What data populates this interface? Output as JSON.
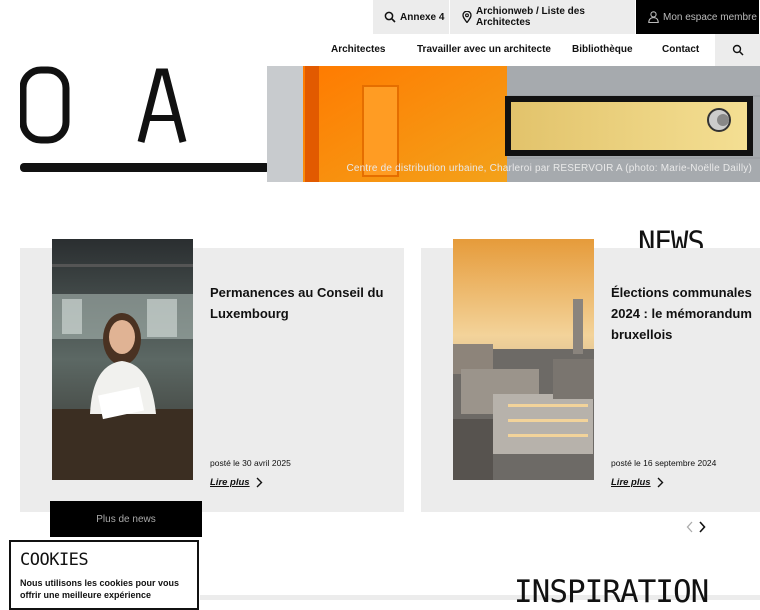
{
  "topbar": {
    "annexe": "Annexe 4",
    "archionweb": "Archionweb / Liste des Architectes",
    "member": "Mon espace membre"
  },
  "nav": {
    "items": [
      "Architectes",
      "Travailler avec un architecte",
      "Bibliothèque",
      "Contact"
    ]
  },
  "logo": {
    "letters": "O A"
  },
  "hero": {
    "caption": "Centre de distribution urbaine, Charleroi par RESERVOIR A (photo: Marie-Noëlle Dailly)"
  },
  "news": {
    "heading": "NEWS",
    "cards": [
      {
        "title": "Permanences au Conseil du Luxembourg",
        "date": "posté le 30 avril 2025",
        "more": "Lire plus"
      },
      {
        "title": "Élections communales 2024 : le mémorandum bruxellois",
        "date": "posté le 16 septembre 2024",
        "more": "Lire plus"
      }
    ],
    "plus": "Plus de news"
  },
  "cookies": {
    "heading": "COOKIES",
    "text": "Nous utilisons les cookies pour vous offrir une meilleure expérience"
  },
  "inspiration": {
    "heading": "INSPIRATION"
  },
  "colors": {
    "panel": "#ececec",
    "accent": "#f29a0e",
    "dark": "#000000"
  }
}
